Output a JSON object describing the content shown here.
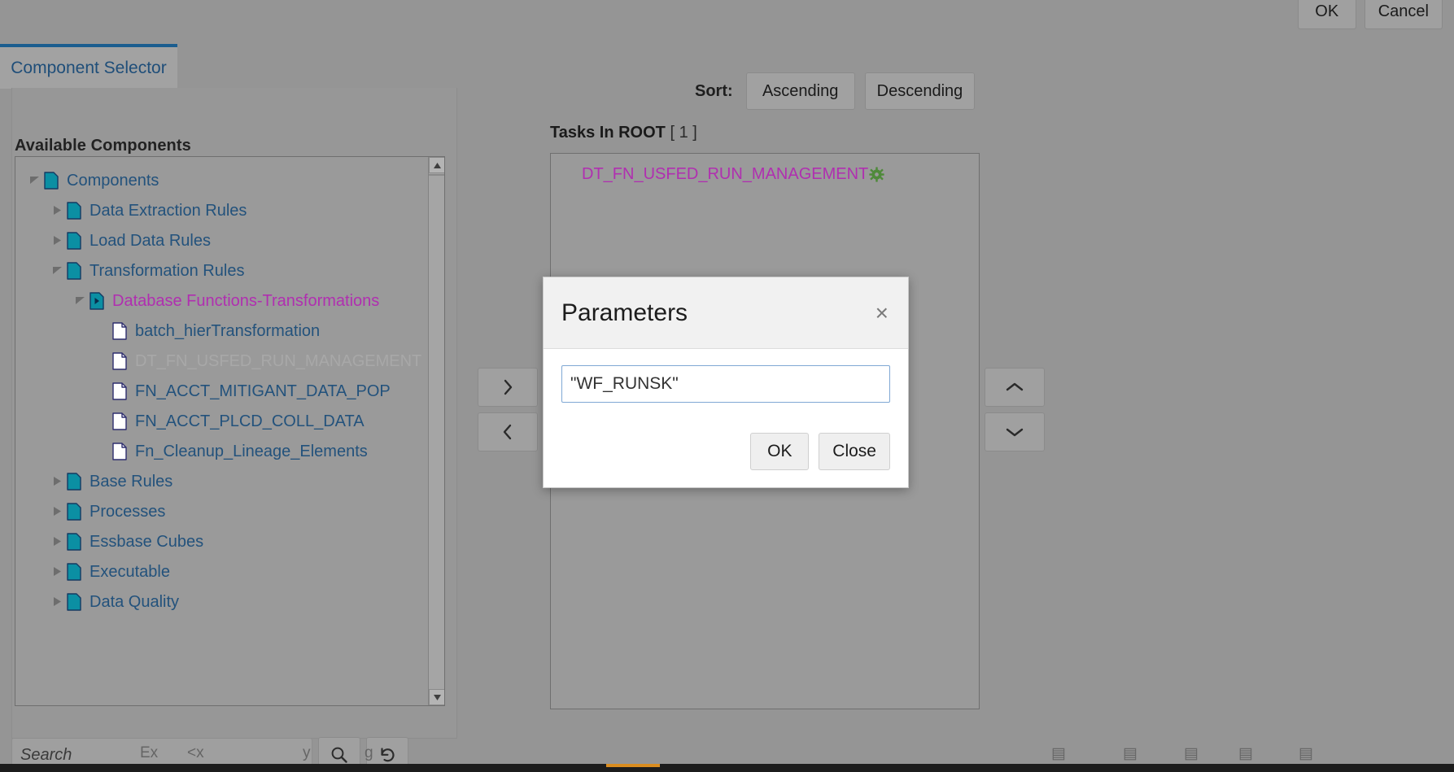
{
  "window": {
    "title": "Component Selector",
    "ok_label": "OK",
    "cancel_label": "Cancel"
  },
  "tabs": [
    {
      "label": "Component Selector",
      "active": true
    }
  ],
  "left_panel": {
    "title": "Available Components",
    "tree": [
      {
        "label": "Components",
        "depth": 0,
        "icon": "teal-document-icon",
        "twisty": "expanded",
        "state": "normal"
      },
      {
        "label": "Data Extraction Rules",
        "depth": 1,
        "icon": "teal-document-icon",
        "twisty": "collapsed",
        "state": "normal"
      },
      {
        "label": "Load Data Rules",
        "depth": 1,
        "icon": "teal-document-icon",
        "twisty": "collapsed",
        "state": "normal"
      },
      {
        "label": "Transformation Rules",
        "depth": 1,
        "icon": "teal-document-icon",
        "twisty": "expanded",
        "state": "normal"
      },
      {
        "label": "Database Functions-Transformations",
        "depth": 2,
        "icon": "teal-play-document-icon",
        "twisty": "expanded",
        "state": "selected"
      },
      {
        "label": "batch_hierTransformation",
        "depth": 3,
        "icon": "white-document-icon",
        "twisty": "none",
        "state": "normal"
      },
      {
        "label": "DT_FN_USFED_RUN_MANAGEMENT",
        "depth": 3,
        "icon": "white-document-icon",
        "twisty": "none",
        "state": "dim"
      },
      {
        "label": "FN_ACCT_MITIGANT_DATA_POP",
        "depth": 3,
        "icon": "white-document-icon",
        "twisty": "none",
        "state": "normal"
      },
      {
        "label": "FN_ACCT_PLCD_COLL_DATA",
        "depth": 3,
        "icon": "white-document-icon",
        "twisty": "none",
        "state": "normal"
      },
      {
        "label": "Fn_Cleanup_Lineage_Elements",
        "depth": 3,
        "icon": "white-document-icon",
        "twisty": "none",
        "state": "normal"
      },
      {
        "label": "Base Rules",
        "depth": 1,
        "icon": "teal-document-icon",
        "twisty": "collapsed",
        "state": "normal"
      },
      {
        "label": "Processes",
        "depth": 1,
        "icon": "teal-document-icon",
        "twisty": "collapsed",
        "state": "normal"
      },
      {
        "label": "Essbase Cubes",
        "depth": 1,
        "icon": "teal-document-icon",
        "twisty": "collapsed",
        "state": "normal"
      },
      {
        "label": "Executable",
        "depth": 1,
        "icon": "teal-document-icon",
        "twisty": "collapsed",
        "state": "normal"
      },
      {
        "label": "Data Quality",
        "depth": 1,
        "icon": "teal-document-icon",
        "twisty": "collapsed",
        "state": "normal"
      }
    ],
    "search": {
      "placeholder": "Search",
      "value": "",
      "search_button_icon": "magnifier-icon",
      "reset_button_icon": "undo-arrow-icon"
    }
  },
  "right_panel": {
    "sort_label": "Sort:",
    "sort_ascending_label": "Ascending",
    "sort_descending_label": "Descending",
    "tasks_heading": "Tasks In ROOT",
    "tasks_count": "[ 1 ]",
    "tasks": [
      {
        "label": "DT_FN_USFED_RUN_MANAGEMENT",
        "gear_icon": "gear-icon",
        "gear_color": "#4f8a3a"
      }
    ]
  },
  "transfer_buttons": [
    {
      "name": "move-right",
      "glyph": "›"
    },
    {
      "name": "move-left",
      "glyph": "‹"
    }
  ],
  "order_buttons": [
    {
      "name": "move-up",
      "glyph": "⌃"
    },
    {
      "name": "move-down",
      "glyph": "⌄"
    }
  ],
  "modal": {
    "title": "Parameters",
    "close_glyph": "×",
    "input_value": "\"WF_RUNSK\"",
    "input_placeholder": "",
    "ok_label": "OK",
    "close_label": "Close"
  },
  "colors": {
    "app_background": "#959595",
    "tab_accent": "#1b5d8f",
    "tree_text": "#23527c",
    "selected_text": "#b02fb0",
    "dim_text": "#a8a8a8",
    "icon_teal": "#0b8fa3",
    "gear_green": "#4f8a3a",
    "modal_background": "#ffffff",
    "input_focus_border": "#7fa8d4"
  }
}
